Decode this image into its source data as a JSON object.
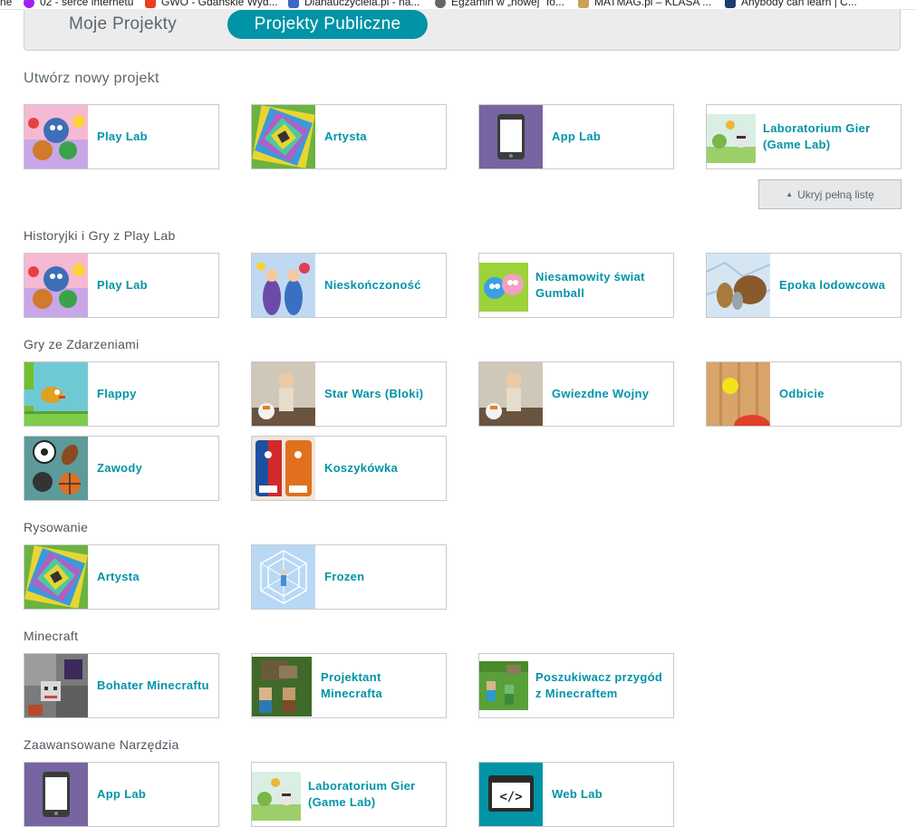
{
  "bookmarks": [
    {
      "label": "ne",
      "color": "#ffffff"
    },
    {
      "label": "02 - serce internetu",
      "color": "#a020f0"
    },
    {
      "label": "GWO - Gdańskie Wyd...",
      "color": "#e8411c"
    },
    {
      "label": "Dlanauczyciela.pl - na...",
      "color": "#3b67c9"
    },
    {
      "label": "Egzamin w „nowej\" fo...",
      "color": "#666666"
    },
    {
      "label": "MATMAG.pl – KLASA ...",
      "color": "#c9a15a"
    },
    {
      "label": "Anybody can learn | C...",
      "color": "#1d3c6e"
    }
  ],
  "tabs": {
    "mine": "Moje Projekty",
    "public": "Projekty Publiczne"
  },
  "create": {
    "title": "Utwórz nowy projekt",
    "cards": [
      {
        "label": "Play Lab",
        "icon": "playlab-thumbnail"
      },
      {
        "label": "Artysta",
        "icon": "artist-thumbnail"
      },
      {
        "label": "App Lab",
        "icon": "applab-thumbnail"
      },
      {
        "label": "Laboratorium Gier (Game Lab)",
        "icon": "gamelab-thumbnail"
      }
    ],
    "hide_button": "Ukryj pełną listę"
  },
  "sections": [
    {
      "title": "Historyjki i Gry z Play Lab",
      "cards": [
        {
          "label": "Play Lab",
          "icon": "playlab-thumbnail"
        },
        {
          "label": "Nieskończoność",
          "icon": "infinity-thumbnail"
        },
        {
          "label": "Niesamowity świat Gumball",
          "icon": "gumball-thumbnail"
        },
        {
          "label": "Epoka lodowcowa",
          "icon": "iceage-thumbnail"
        }
      ]
    },
    {
      "title": "Gry ze Zdarzeniami",
      "cards": [
        {
          "label": "Flappy",
          "icon": "flappy-thumbnail"
        },
        {
          "label": "Star Wars (Bloki)",
          "icon": "starwars-thumbnail"
        },
        {
          "label": "Gwiezdne Wojny",
          "icon": "starwars-thumbnail"
        },
        {
          "label": "Odbicie",
          "icon": "bounce-thumbnail"
        },
        {
          "label": "Zawody",
          "icon": "sports-thumbnail"
        },
        {
          "label": "Koszykówka",
          "icon": "basketball-thumbnail"
        }
      ]
    },
    {
      "title": "Rysowanie",
      "cards": [
        {
          "label": "Artysta",
          "icon": "artist-thumbnail"
        },
        {
          "label": "Frozen",
          "icon": "frozen-thumbnail"
        }
      ]
    },
    {
      "title": "Minecraft",
      "cards": [
        {
          "label": "Bohater Minecraftu",
          "icon": "minecraft-hero-thumbnail"
        },
        {
          "label": "Projektant Minecrafta",
          "icon": "minecraft-designer-thumbnail"
        },
        {
          "label": "Poszukiwacz przygód z Minecraftem",
          "icon": "minecraft-adventurer-thumbnail"
        }
      ]
    },
    {
      "title": "Zaawansowane Narzędzia",
      "cards": [
        {
          "label": "App Lab",
          "icon": "applab-thumbnail"
        },
        {
          "label": "Laboratorium Gier (Game Lab)",
          "icon": "gamelab-thumbnail"
        },
        {
          "label": "Web Lab",
          "icon": "weblab-thumbnail"
        }
      ]
    }
  ],
  "colors": {
    "accent": "#0094a6",
    "applab_purple": "#7665a0",
    "weblab_teal": "#0094a6"
  }
}
